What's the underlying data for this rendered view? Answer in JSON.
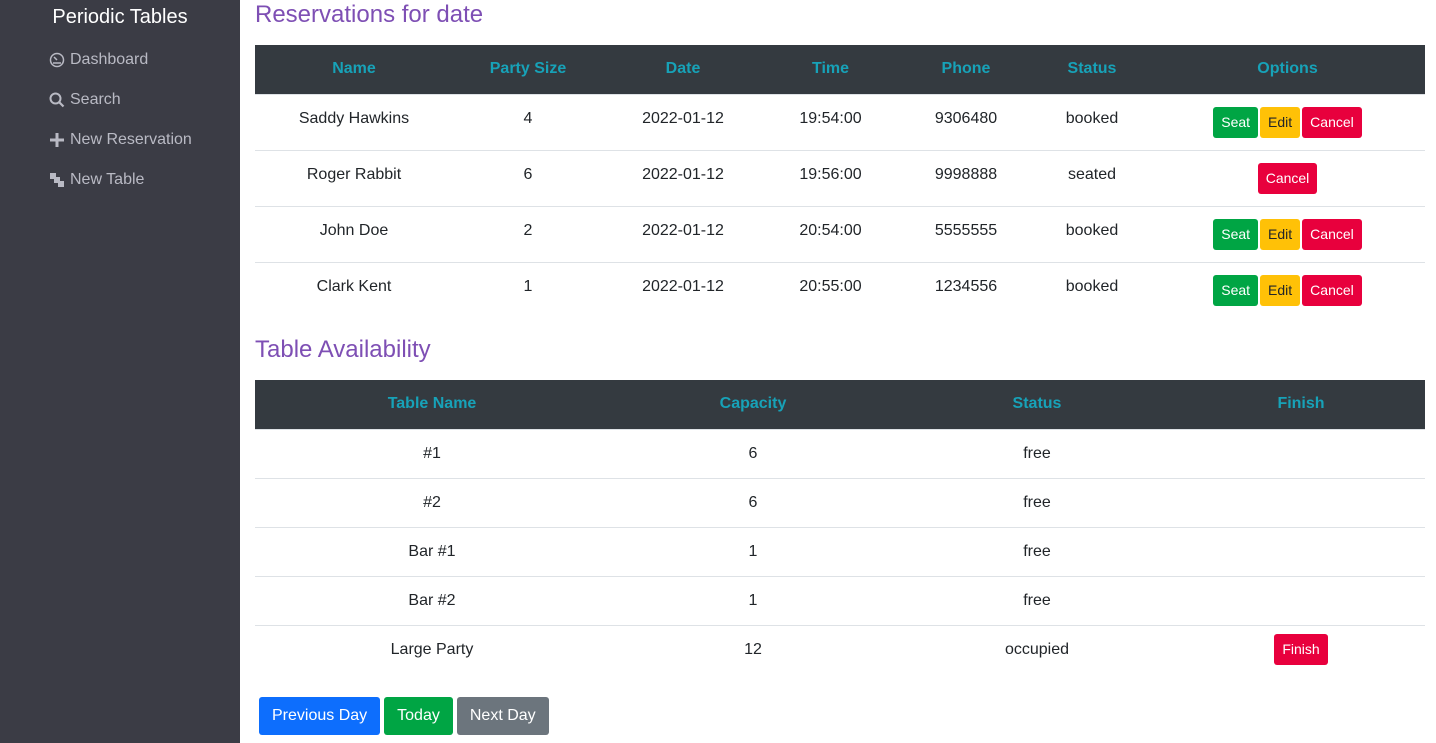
{
  "sidebar": {
    "brand": "Periodic Tables",
    "items": [
      {
        "label": "Dashboard",
        "icon": "dashboard-icon"
      },
      {
        "label": "Search",
        "icon": "search-icon"
      },
      {
        "label": "New Reservation",
        "icon": "plus-icon"
      },
      {
        "label": "New Table",
        "icon": "layers-icon"
      }
    ]
  },
  "reservations": {
    "title": "Reservations for date",
    "headers": [
      "Name",
      "Party Size",
      "Date",
      "Time",
      "Phone",
      "Status",
      "Options"
    ],
    "rows": [
      {
        "name": "Saddy Hawkins",
        "party": "4",
        "date": "2022-01-12",
        "time": "19:54:00",
        "phone": "9306480",
        "status": "booked",
        "actions": [
          "Seat",
          "Edit",
          "Cancel"
        ]
      },
      {
        "name": "Roger Rabbit",
        "party": "6",
        "date": "2022-01-12",
        "time": "19:56:00",
        "phone": "9998888",
        "status": "seated",
        "actions": [
          "Cancel"
        ]
      },
      {
        "name": "John Doe",
        "party": "2",
        "date": "2022-01-12",
        "time": "20:54:00",
        "phone": "5555555",
        "status": "booked",
        "actions": [
          "Seat",
          "Edit",
          "Cancel"
        ]
      },
      {
        "name": "Clark Kent",
        "party": "1",
        "date": "2022-01-12",
        "time": "20:55:00",
        "phone": "1234556",
        "status": "booked",
        "actions": [
          "Seat",
          "Edit",
          "Cancel"
        ]
      }
    ]
  },
  "tables": {
    "title": "Table Availability",
    "headers": [
      "Table Name",
      "Capacity",
      "Status",
      "Finish"
    ],
    "rows": [
      {
        "name": "#1",
        "capacity": "6",
        "status": "free",
        "finish": ""
      },
      {
        "name": "#2",
        "capacity": "6",
        "status": "free",
        "finish": ""
      },
      {
        "name": "Bar #1",
        "capacity": "1",
        "status": "free",
        "finish": ""
      },
      {
        "name": "Bar #2",
        "capacity": "1",
        "status": "free",
        "finish": ""
      },
      {
        "name": "Large Party",
        "capacity": "12",
        "status": "occupied",
        "finish": "Finish"
      }
    ]
  },
  "footer": {
    "previous": "Previous Day",
    "today": "Today",
    "next": "Next Day"
  },
  "colors": {
    "sidebar_bg": "#3b3c45",
    "title": "#7e4fb4",
    "header_bg": "#343a40",
    "header_text": "#17a2b8",
    "seat": "#00a544",
    "edit": "#ffc107",
    "cancel": "#e8003d",
    "prev": "#0d6efd",
    "next": "#6c757d"
  }
}
